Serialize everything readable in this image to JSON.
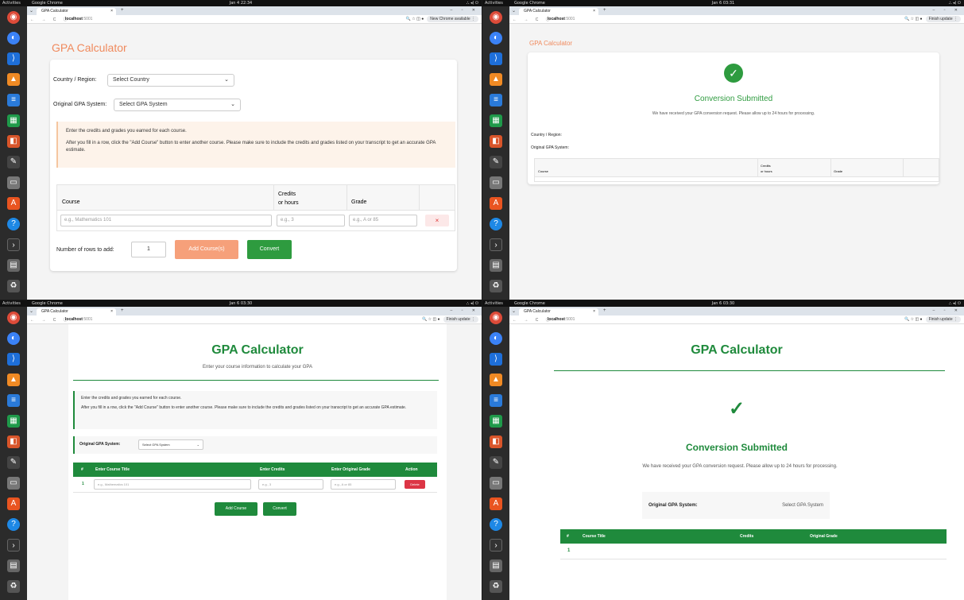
{
  "topbar": {
    "activities": "Activities",
    "app": "Google Chrome",
    "tray": "⛬ ◂) ⏻"
  },
  "browser": {
    "tab_title": "GPA Calculator",
    "tab_close": "×",
    "new_tab": "+",
    "url_host": "localhost",
    "url_port": ":5001",
    "nav": "← → C ⓘ",
    "icons": "🔍 ☆ ◫ ●"
  },
  "q1": {
    "clock": "Jan 4 22:34",
    "update": "New Chrome available ⋮",
    "title": "GPA Calculator",
    "country_label": "Country / Region:",
    "country_value": "Select Country",
    "system_label": "Original GPA System:",
    "system_value": "Select GPA System",
    "notice_1": "Enter the credits and grades you earned for each course.",
    "notice_2": "After you fill in a row, click the \"Add Course\" button to enter another course. Please make sure to include the credits and grades listed on your transcript to get an accurate GPA estimate.",
    "col_course": "Course",
    "col_credits_1": "Credits",
    "col_credits_2": "or hours",
    "col_grade": "Grade",
    "ph_course": "e.g., Mathematics 101",
    "ph_credits": "e.g., 3",
    "ph_grade": "e.g., A or 85",
    "delete_x": "×",
    "rows_label": "Number of rows to add:",
    "rows_value": "1",
    "add_btn": "Add Course(s)",
    "convert_btn": "Convert"
  },
  "q2": {
    "clock": "Jan 6 03:31",
    "update": "Finish update ⋮",
    "title": "GPA Calculator",
    "check": "✓",
    "heading": "Conversion Submitted",
    "message": "We have received your GPA conversion request. Please allow up to 24 hours for processing.",
    "country_label": "Country / Region:",
    "system_label": "Original GPA System:",
    "col_course": "Course",
    "col_credits_1": "Credits",
    "col_credits_2": "or hours",
    "col_grade": "Grade"
  },
  "q3": {
    "clock": "Jan 6 03:30",
    "update": "Finish update ⋮",
    "title": "GPA Calculator",
    "subtitle": "Enter your course information to calculate your GPA",
    "notice_1": "Enter the credits and grades you earned for each course.",
    "notice_2": "After you fill in a row, click the \"Add Course\" button to enter another course. Please make sure to include the credits and grades listed on your transcript to get an accurate GPA estimate.",
    "system_label": "Original GPA System:",
    "system_value": "Select GPA System",
    "col_num": "#",
    "col_title": "Enter Course Title",
    "col_credits": "Enter Credits",
    "col_grade": "Enter Original Grade",
    "col_action": "Action",
    "row_num": "1",
    "ph_course": "e.g., Mathematics 101",
    "ph_credits": "e.g., 3",
    "ph_grade": "e.g., A or 85",
    "delete_btn": "Delete",
    "add_btn": "Add Course",
    "convert_btn": "Convert"
  },
  "q4": {
    "clock": "Jan 6 03:30",
    "update": "Finish update ⋮",
    "title": "GPA Calculator",
    "check": "✓",
    "heading": "Conversion Submitted",
    "message": "We have received your GPA conversion request. Please allow up to 24 hours for processing.",
    "system_label": "Original GPA System:",
    "system_value": "Select GPA System",
    "col_num": "#",
    "col_title": "Course Title",
    "col_credits": "Credits",
    "col_grade": "Original Grade",
    "row_num": "1"
  },
  "colors": {
    "orange": "#f08a5d",
    "green": "#1f8a3c",
    "accent_green": "#2e9b3f"
  }
}
